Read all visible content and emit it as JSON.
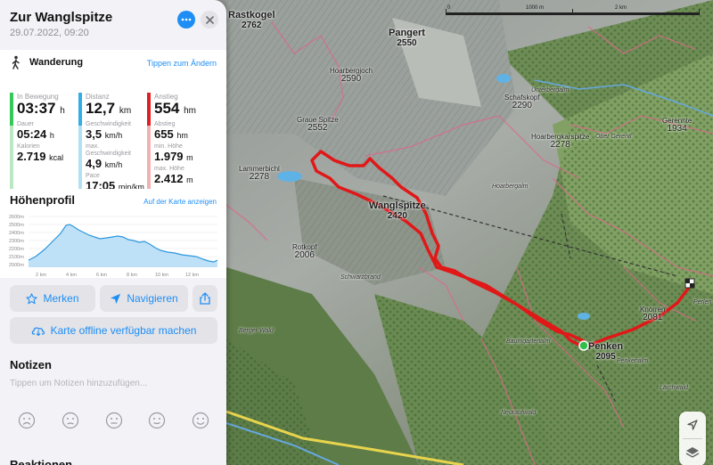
{
  "panel": {
    "title": "Zur Wanglspitze",
    "date": "29.07.2022, 09:20",
    "activity": {
      "label": "Wanderung",
      "change_link": "Tippen zum Ändern",
      "icon": "hiker-icon"
    },
    "stats": {
      "moving": {
        "label": "In Bewegung",
        "value": "03:37",
        "unit": "h",
        "color": "#34c759"
      },
      "duration": {
        "label": "Dauer",
        "value": "05:24",
        "unit": "h"
      },
      "calories": {
        "label": "Kalorien",
        "value": "2.719",
        "unit": "kcal"
      },
      "distance": {
        "label": "Distanz",
        "value": "12,7",
        "unit": "km",
        "color": "#32ade6"
      },
      "speed": {
        "label": "Geschwindigkeit",
        "value": "3,5",
        "unit": "km/h"
      },
      "max_speed": {
        "label": "max. Geschwindigkeit",
        "value": "4,9",
        "unit": "km/h"
      },
      "pace": {
        "label": "Pace",
        "value": "17:05",
        "unit": "min/km"
      },
      "ascent": {
        "label": "Anstieg",
        "value": "554",
        "unit": "hm",
        "color": "#e02020"
      },
      "descent": {
        "label": "Abstieg",
        "value": "655",
        "unit": "hm"
      },
      "min_height": {
        "label": "min. Höhe",
        "value": "1.979",
        "unit": "m"
      },
      "max_height": {
        "label": "max. Höhe",
        "value": "2.412",
        "unit": "m"
      }
    },
    "profile": {
      "title": "Höhenprofil",
      "map_link": "Auf der Karte anzeigen",
      "y_ticks": [
        "2600m",
        "2500m",
        "2400m",
        "2300m",
        "2200m",
        "2100m",
        "2000m"
      ],
      "x_ticks": [
        "2 km",
        "4 km",
        "6 km",
        "8 km",
        "10 km",
        "12 km"
      ]
    },
    "buttons": {
      "bookmark": "Merken",
      "navigate": "Navigieren",
      "offline": "Karte offline verfügbar machen"
    },
    "notes": {
      "title": "Notizen",
      "placeholder": "Tippen um Notizen hinzuzufügen..."
    },
    "reactions_title": "Reaktionen"
  },
  "map": {
    "scale_labels": [
      "0",
      "1000 m",
      "2 km"
    ],
    "peaks": [
      {
        "name": "Rastkogel",
        "elev": "2762"
      },
      {
        "name": "Pangert",
        "elev": "2550"
      },
      {
        "name": "Hoarbergjoch",
        "elev": "2590"
      },
      {
        "name": "Schafskopf",
        "elev": "2290"
      },
      {
        "name": "Graue Spitze",
        "elev": "2552"
      },
      {
        "name": "Hoarbergkarspitze",
        "elev": "2278"
      },
      {
        "name": "Gerennte",
        "elev": "1934"
      },
      {
        "name": "Lammerbichl",
        "elev": "2278"
      },
      {
        "name": "Wanglspitze",
        "elev": "2420"
      },
      {
        "name": "Rotkopf",
        "elev": "2006"
      },
      {
        "name": "Knorren",
        "elev": "2081"
      },
      {
        "name": "Penken",
        "elev": "2095"
      }
    ],
    "places": [
      "Unterbergalm",
      "Ober Gerentl",
      "Hoarbergalm",
      "Schwarzbrand",
      "Baumgartenalm",
      "Neuraufwald",
      "Penkenalm",
      "Berger Wald",
      "Lärchwald",
      "Perlen"
    ]
  }
}
